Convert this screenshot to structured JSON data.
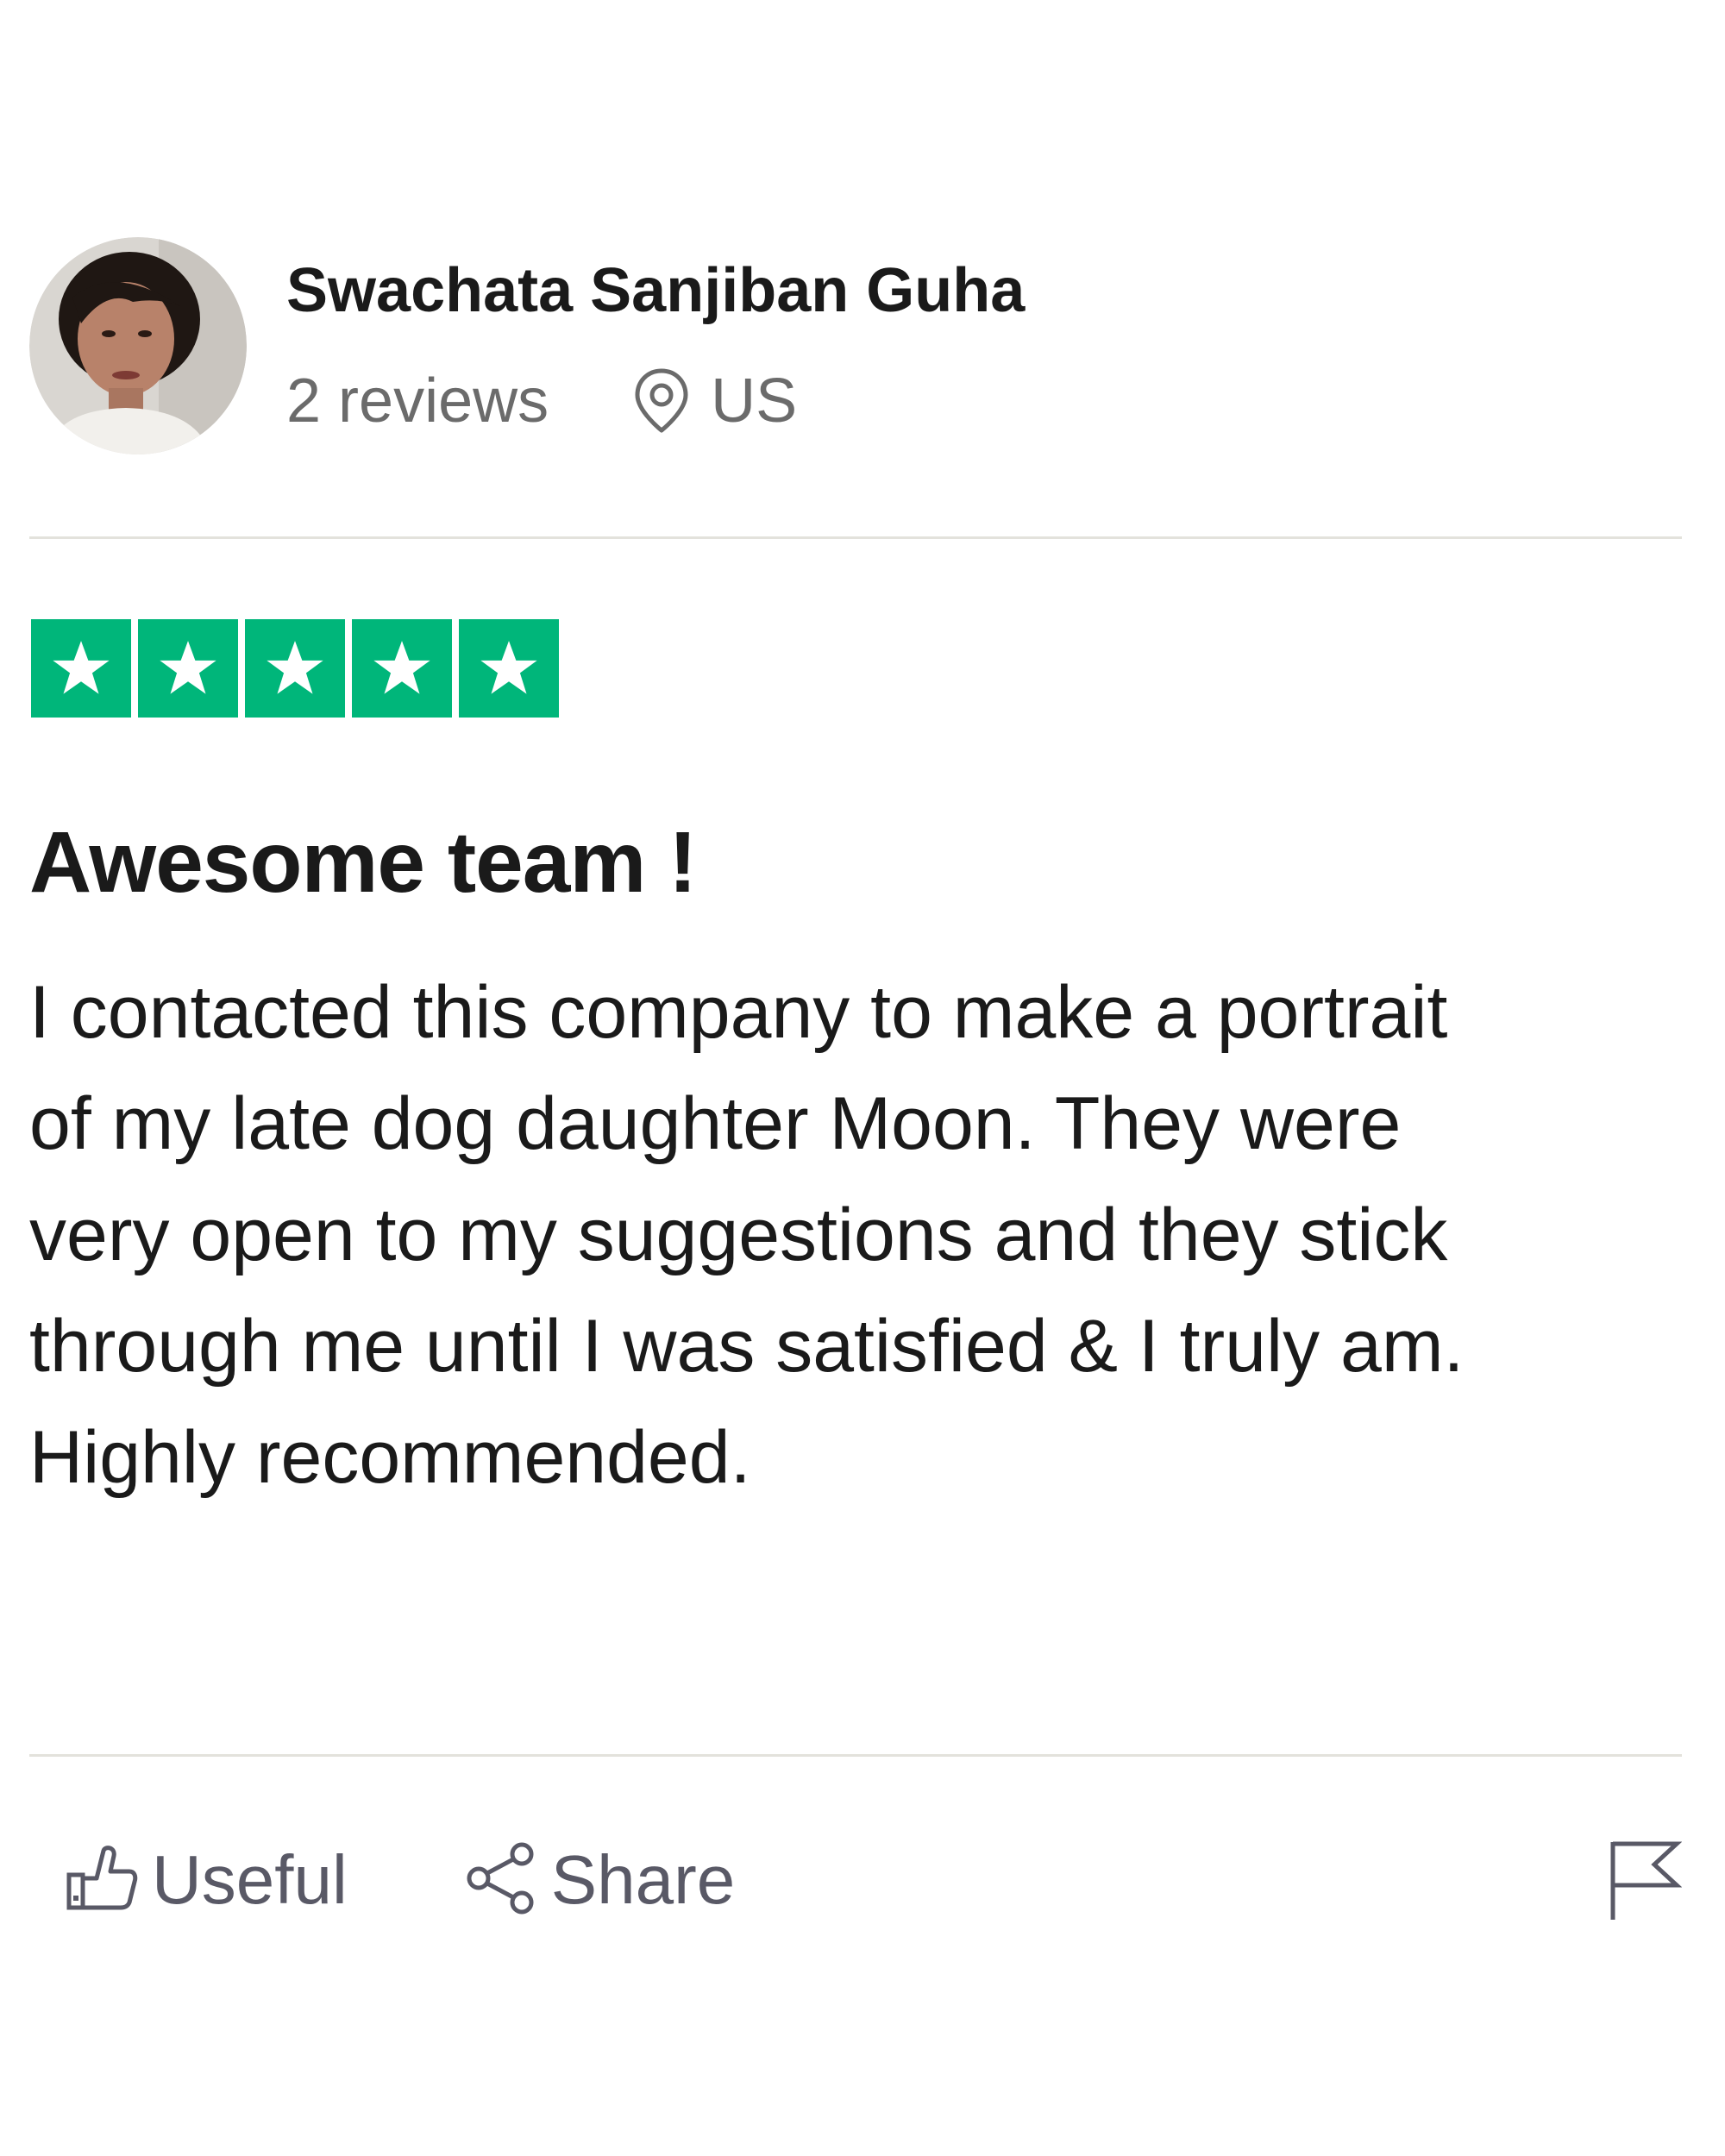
{
  "reviewer": {
    "name": "Swachata Sanjiban Guha",
    "review_count": "2 reviews",
    "location": "US",
    "avatar_icon": "user-avatar-photo"
  },
  "rating": {
    "stars": 5,
    "max_stars": 5,
    "color": "#00b67a"
  },
  "review": {
    "title": "Awesome team !",
    "body_lines": [
      "I contacted this company to make a portrait",
      "of my late dog daughter Moon. They were",
      "very open to my suggestions and they stick",
      "through me until I was satisfied & I truly am.",
      "Highly recommended."
    ]
  },
  "actions": {
    "useful_label": "Useful",
    "share_label": "Share",
    "useful_icon": "thumbs-up-icon",
    "share_icon": "share-icon",
    "report_icon": "flag-icon"
  },
  "colors": {
    "text_primary": "#1a1a1a",
    "text_secondary": "#6b6b6b",
    "action_text": "#595966",
    "divider": "#e3e2dc"
  }
}
